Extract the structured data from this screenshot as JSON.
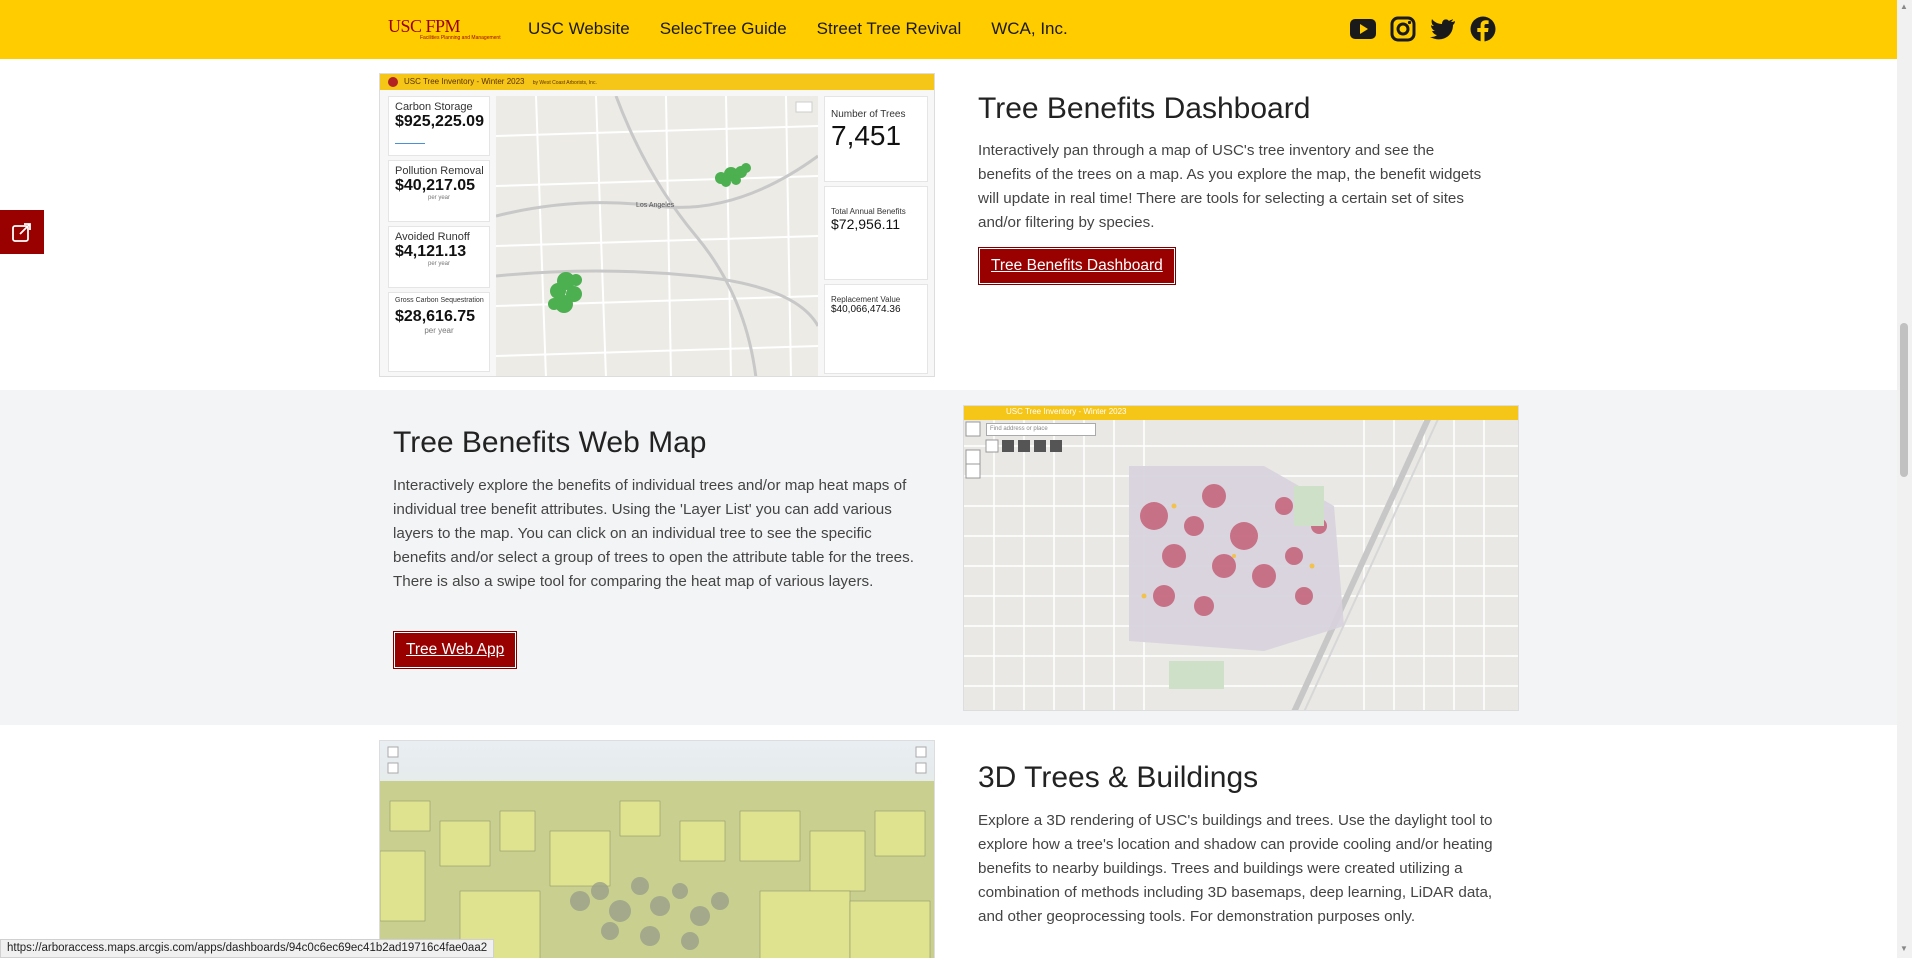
{
  "header": {
    "logo_text": "USC FPM",
    "logo_sub": "Facilities Planning and Management",
    "nav": [
      "USC Website",
      "SelecTree Guide",
      "Street Tree Revival",
      "WCA, Inc."
    ],
    "social_icons": [
      "youtube-icon",
      "instagram-icon",
      "twitter-icon",
      "facebook-icon"
    ],
    "brand_color": "#ffcc00"
  },
  "sections": [
    {
      "title": "Tree Benefits Dashboard",
      "text": "Interactively pan through a map of USC's tree inventory and see the benefits of the trees on a map. As you explore the map, the benefit widgets will update in real time! There are tools for selecting a certain set of sites and/or filtering by species.",
      "button": "Tree Benefits Dashboard"
    },
    {
      "title": "Tree Benefits Web Map",
      "text": "Interactively explore the benefits of individual trees and/or map heat maps of individual tree benefit attributes. Using the 'Layer List' you can add various layers to the map. You can click on an individual tree to see the specific benefits and/or select a group of trees to open the attribute table for the trees. There is also a swipe tool for comparing the heat map of various layers.",
      "button": "Tree Web App"
    },
    {
      "title": "3D Trees & Buildings",
      "text": "Explore a 3D rendering of USC's buildings and trees. Use the daylight tool to explore how a tree's location and shadow can provide cooling and/or heating benefits to nearby buildings. Trees and buildings were created utilizing a combination of methods including 3D basemaps, deep learning, LiDAR data, and other geoprocessing tools. For demonstration purposes only."
    }
  ],
  "dashboard_thumb": {
    "bar_title": "USC Tree Inventory - Winter 2023",
    "bar_sub": "by West Coast Arborists, Inc.",
    "carbon_storage_label": "Carbon Storage",
    "carbon_storage_value": "$925,225.09",
    "pollution_label": "Pollution Removal",
    "pollution_value": "$40,217.05",
    "runoff_label": "Avoided Runoff",
    "runoff_value": "$4,121.13",
    "sequestration_label": "Gross Carbon Sequestration",
    "sequestration_value": "$28,616.75",
    "per_year": "per year",
    "trees_label": "Number of Trees",
    "trees_value": "7,451",
    "annual_label": "Total Annual Benefits",
    "annual_value": "$72,956.11",
    "replacement_label": "Replacement Value",
    "replacement_value": "$40,066,474.36",
    "map_label_la": "Los Angeles"
  },
  "webmap_thumb": {
    "bar_title": "USC Tree Inventory - Winter 2023",
    "search_placeholder": "Find address or place"
  },
  "status_url": "https://arboraccess.maps.arcgis.com/apps/dashboards/94c0c6ec69ec41b2ad19716c4fae0aa2"
}
